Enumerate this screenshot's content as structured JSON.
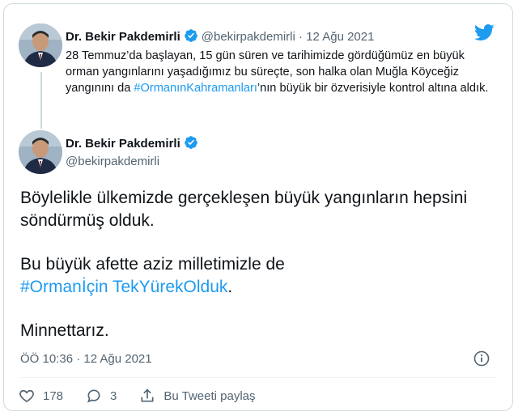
{
  "quoted": {
    "name": "Dr. Bekir Pakdemirli",
    "handle": "@bekirpakdemirli",
    "separator": "·",
    "date": "12 Ağu 2021",
    "text_before": "28 Temmuz’da başlayan, 15 gün süren ve tarihimizde gördüğümüz en büyük orman yangınlarını yaşadığımız bu süreçte, son halka olan Muğla Köyceğiz yangınını da ",
    "hashtag": "#OrmanınKahramanları",
    "text_after": "’nın büyük bir özverisiyle kontrol altına aldık."
  },
  "main": {
    "name": "Dr. Bekir Pakdemirli",
    "handle": "@bekirpakdemirli",
    "paragraph1": "Böylelikle ülkemizde gerçekleşen büyük yangınların hepsini söndürmüş olduk.",
    "paragraph2_text": "Bu büyük afette aziz milletimizle de",
    "paragraph2_hashtag": "#Ormanİçin TekYürekOlduk",
    "paragraph2_end": ".",
    "paragraph3": "Minnettarız.",
    "timestamp": "ÖÖ 10:36 · 12 Ağu 2021"
  },
  "actions": {
    "likes": "178",
    "replies": "3",
    "share_label": "Bu Tweeti paylaş"
  },
  "icons": {
    "logo": "twitter-bird-icon",
    "verified": "verified-badge-icon",
    "info": "info-icon",
    "like": "heart-icon",
    "reply": "reply-icon",
    "share": "share-icon"
  },
  "colors": {
    "accent": "#1d9bf0",
    "text": "#0f1419",
    "muted": "#536471",
    "border": "#cfd9de"
  }
}
